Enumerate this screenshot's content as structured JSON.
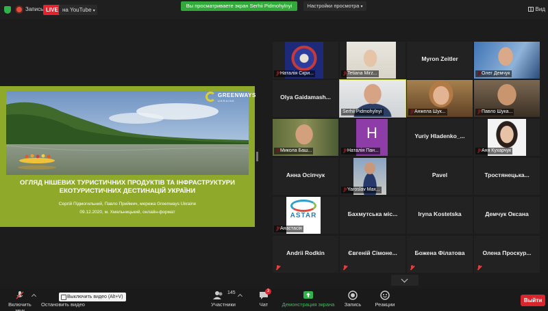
{
  "topbar": {
    "record_label": "Запись",
    "live_badge": "LIVE",
    "live_target": "на YouTube",
    "viewing_banner": "Вы просматриваете экран Serhii Pidmohylnyi",
    "view_settings": "Настройки просмотра",
    "view_button": "Вид"
  },
  "slide": {
    "logo_text": "GREENWAYS",
    "logo_sub": "UKRAINE",
    "title": "ОГЛЯД НІШЕВИХ ТУРИСТИЧНИХ ПРОДУКТІВ ТА ІНФРАСТРУКТУРИ ЕКОТУРИСТИЧНИХ ДЕСТИНАЦІЙ УКРАЇНИ",
    "authors": "Сергій Підмогильний, Павло Приймич, мережа Greenways Ukraine",
    "date_place": "09.12.2020, м. Хмельницький, онлайн-формат"
  },
  "participants": [
    {
      "name": "Наталія Скри..."
    },
    {
      "name": "Tetiana Mirz..."
    },
    {
      "name": "Myron  Zeitler"
    },
    {
      "name": "Олег Демчук"
    },
    {
      "name": "Olya  Gaidamash..."
    },
    {
      "name": "Serhii Pidmohylnyi"
    },
    {
      "name": "Анжела Шук..."
    },
    {
      "name": "Павло Шука..."
    },
    {
      "name": "Микола Баш..."
    },
    {
      "name": "Наталія Пан...",
      "initial": "H"
    },
    {
      "name": "Yuriy  Hladenko_..."
    },
    {
      "name": "Аня Кухарчук"
    },
    {
      "name": "Анна Осіпчук"
    },
    {
      "name": "Yaroslav Max..."
    },
    {
      "name": "Pavel"
    },
    {
      "name": "Тростянецька..."
    },
    {
      "name": "Анастасія",
      "logo": "ASTAR"
    },
    {
      "name": "Бахмутська  міс..."
    },
    {
      "name": "Iryna Kostetska"
    },
    {
      "name": "Демчук Оксана"
    },
    {
      "name": "Andrii Rodkin"
    },
    {
      "name": "Євгеній  Сімоне..."
    },
    {
      "name": "Божена Філатова"
    },
    {
      "name": "Олена  Проскур..."
    }
  ],
  "toolbar": {
    "unmute": "Включить звук",
    "stop_video": "Остановить видео",
    "video_tooltip": "Выключить видео (Alt+V)",
    "participants": "Участники",
    "participants_count": "145",
    "chat": "Чат",
    "chat_badge": "3",
    "share": "Демонстрация экрана",
    "record": "Запись",
    "reactions": "Реакции",
    "leave": "Выйти"
  },
  "colors": {
    "slide_bg": "#8faa2a",
    "viewing_banner": "#33a83b",
    "leave": "#d9262c",
    "live": "#e5232f",
    "active_speaker": "#c8d34a"
  }
}
